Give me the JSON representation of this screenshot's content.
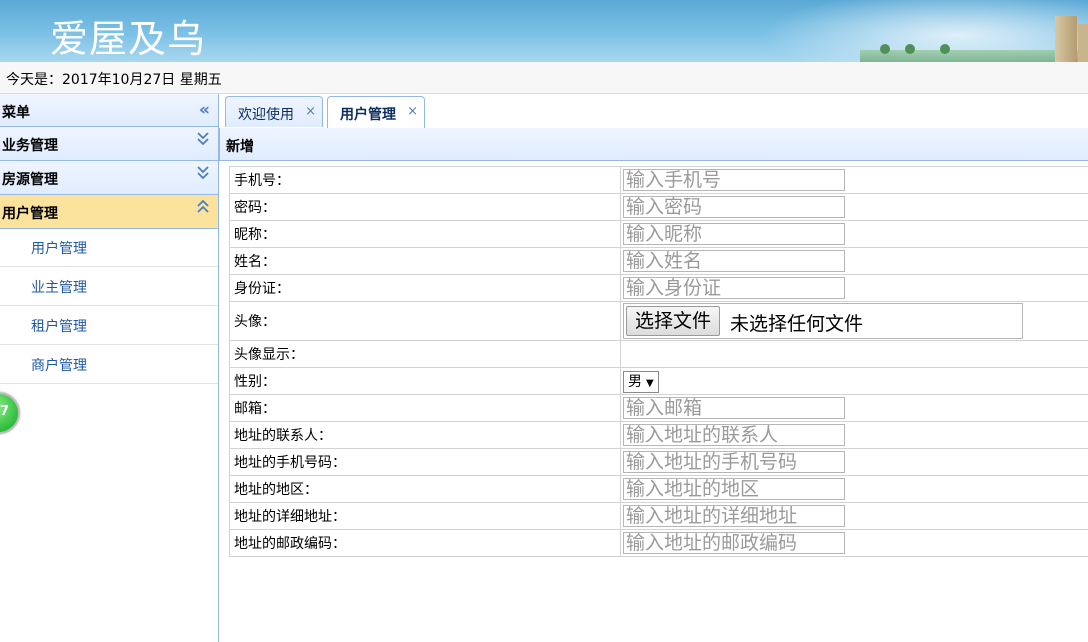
{
  "header": {
    "logo_text": "爱屋及乌"
  },
  "datebar": {
    "text": "今天是：2017年10月27日 星期五"
  },
  "sidebar": {
    "title": "菜单",
    "collapse_icon": "double-chevron-left-icon",
    "groups": [
      {
        "label": "业务管理",
        "icon": "double-chevron-down-icon"
      },
      {
        "label": "房源管理",
        "icon": "double-chevron-down-icon"
      },
      {
        "label": "用户管理",
        "icon": "double-chevron-up-icon",
        "active": true
      }
    ],
    "items": [
      "用户管理",
      "业主管理",
      "租户管理",
      "商户管理"
    ],
    "badge_text": "7"
  },
  "tabs": [
    {
      "label": "欢迎使用",
      "close": "×"
    },
    {
      "label": "用户管理",
      "close": "×",
      "active": true
    }
  ],
  "panel": {
    "title": "新增"
  },
  "form": {
    "phone": {
      "label": "手机号：",
      "placeholder": "输入手机号"
    },
    "password": {
      "label": "密码：",
      "placeholder": "输入密码"
    },
    "nickname": {
      "label": "昵称：",
      "placeholder": "输入昵称"
    },
    "name": {
      "label": "姓名：",
      "placeholder": "输入姓名"
    },
    "idcard": {
      "label": "身份证：",
      "placeholder": "输入身份证"
    },
    "avatar": {
      "label": "头像：",
      "button": "选择文件",
      "status": "未选择任何文件"
    },
    "avatar_display": {
      "label": "头像显示："
    },
    "gender": {
      "label": "性别：",
      "value": "男"
    },
    "email": {
      "label": "邮箱：",
      "placeholder": "输入邮箱"
    },
    "addr_contact": {
      "label": "地址的联系人：",
      "placeholder": "输入地址的联系人"
    },
    "addr_phone": {
      "label": "地址的手机号码：",
      "placeholder": "输入地址的手机号码"
    },
    "addr_region": {
      "label": "地址的地区：",
      "placeholder": "输入地址的地区"
    },
    "addr_detail": {
      "label": "地址的详细地址：",
      "placeholder": "输入地址的详细地址"
    },
    "addr_zip": {
      "label": "地址的邮政编码：",
      "placeholder": "输入地址的邮政编码"
    }
  }
}
